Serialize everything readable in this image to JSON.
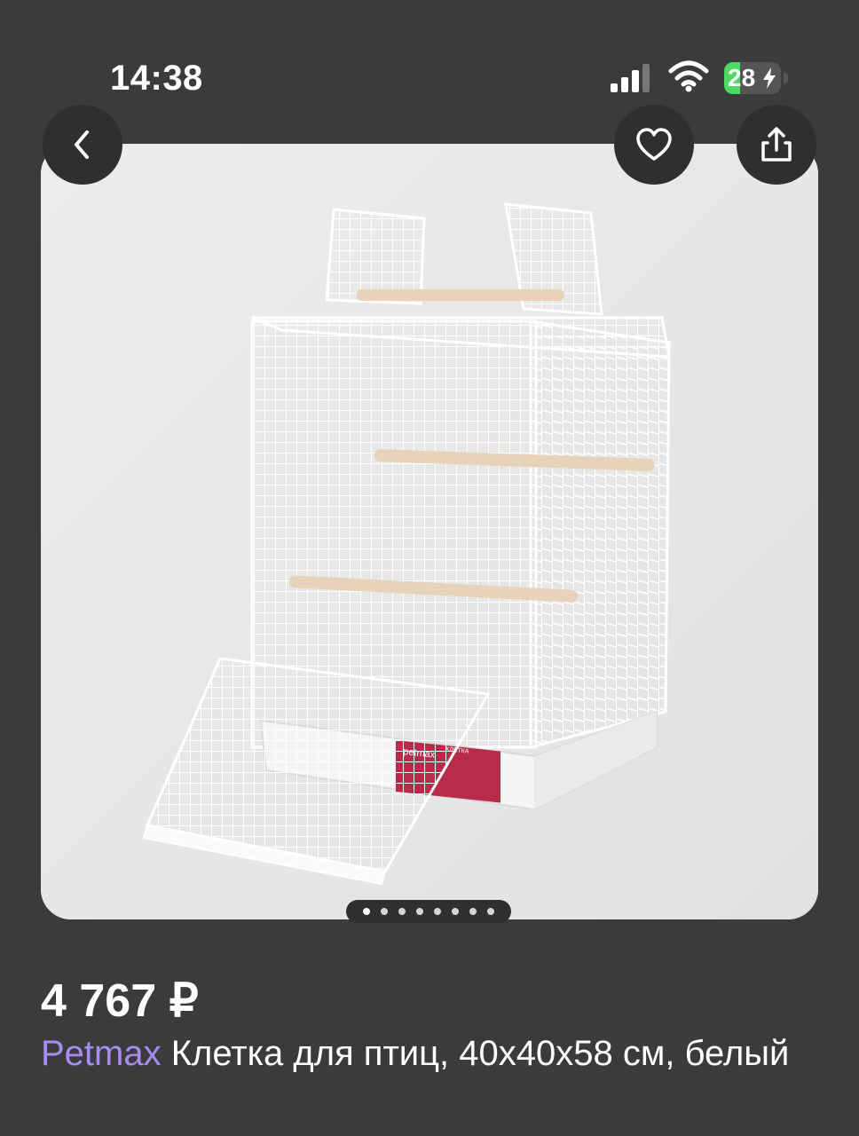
{
  "status_bar": {
    "time": "14:38",
    "battery_level": "28",
    "battery_fraction": 0.28
  },
  "product": {
    "price": "4 767 ₽",
    "brand": "Petmax",
    "name": "Клетка для птиц, 40x40x58 см, белый"
  },
  "gallery": {
    "total_images": 8,
    "current_index": 1
  },
  "image_label": {
    "brand": "petmax",
    "name": "КЛЕТКА"
  },
  "icons": [
    "chevron-left-icon",
    "heart-icon",
    "share-icon",
    "cellular-signal-icon",
    "wifi-icon",
    "battery-charging-icon"
  ],
  "colors": {
    "background": "#3b3b3b",
    "brand_accent": "#a58cf6",
    "battery": "#4cd964"
  }
}
